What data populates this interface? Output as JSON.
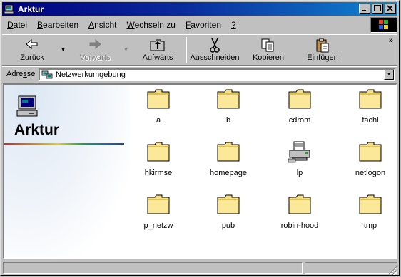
{
  "window": {
    "title": "Arktur"
  },
  "menu": [
    {
      "prefix": "",
      "key": "D",
      "rest": "atei"
    },
    {
      "prefix": "",
      "key": "B",
      "rest": "earbeiten"
    },
    {
      "prefix": "",
      "key": "A",
      "rest": "nsicht"
    },
    {
      "prefix": "",
      "key": "W",
      "rest": "echseln zu"
    },
    {
      "prefix": "",
      "key": "F",
      "rest": "avoriten"
    },
    {
      "prefix": "",
      "key": "?",
      "rest": ""
    }
  ],
  "toolbar": {
    "back_label": "Zurück",
    "forward_label": "Vorwärts",
    "up_label": "Aufwärts",
    "cut_label": "Ausschneiden",
    "copy_label": "Kopieren",
    "paste_label": "Einfügen",
    "more": "»"
  },
  "address": {
    "label": "Adresse",
    "label_key": "s",
    "value": "Netzwerkumgebung"
  },
  "leftpane": {
    "title": "Arktur"
  },
  "items": [
    {
      "name": "a",
      "type": "folder"
    },
    {
      "name": "b",
      "type": "folder"
    },
    {
      "name": "cdrom",
      "type": "folder"
    },
    {
      "name": "fachl",
      "type": "folder"
    },
    {
      "name": "hkirmse",
      "type": "folder"
    },
    {
      "name": "homepage",
      "type": "folder"
    },
    {
      "name": "lp",
      "type": "printer"
    },
    {
      "name": "netlogon",
      "type": "folder"
    },
    {
      "name": "p_netzw",
      "type": "folder"
    },
    {
      "name": "pub",
      "type": "folder"
    },
    {
      "name": "robin-hood",
      "type": "folder"
    },
    {
      "name": "tmp",
      "type": "folder"
    }
  ],
  "colors": {
    "titlebar_start": "#000080",
    "titlebar_end": "#1084d0",
    "folder": "#f8e080"
  }
}
